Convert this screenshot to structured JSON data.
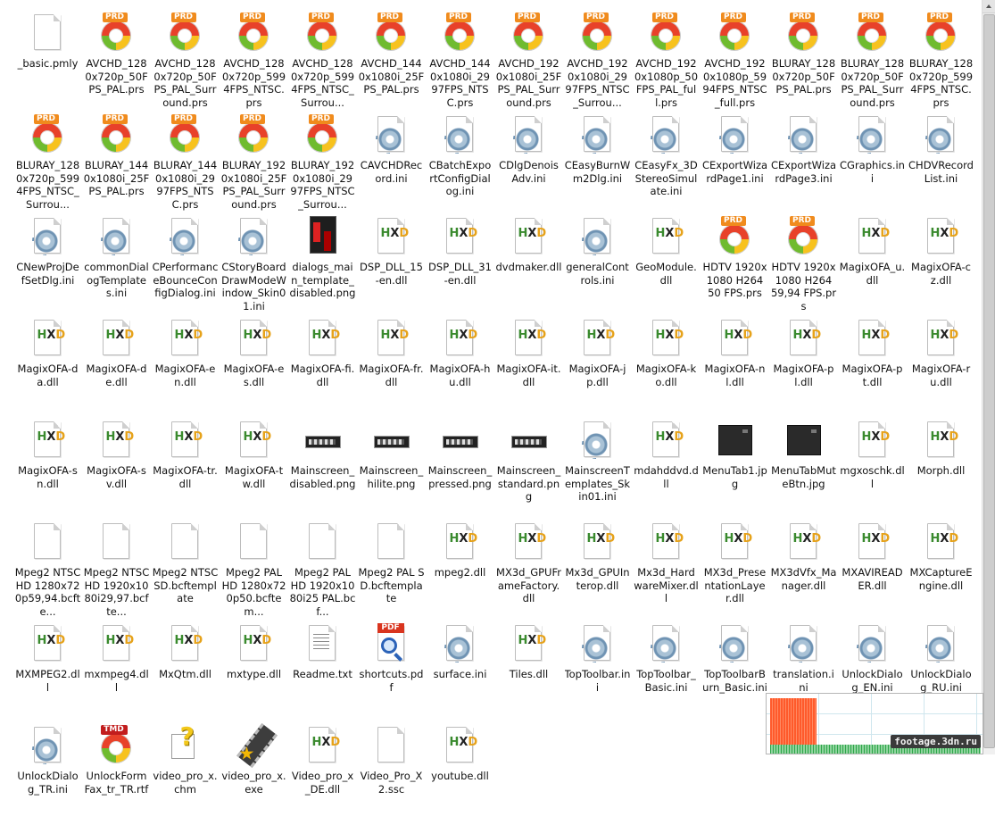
{
  "files": [
    {
      "name": "_basic.pmly",
      "icon": "document-icon"
    },
    {
      "name": "AVCHD_1280x720p_50FPS_PAL.prs",
      "icon": "prd-preset-icon"
    },
    {
      "name": "AVCHD_1280x720p_50FPS_PAL_Surround.prs",
      "icon": "prd-preset-icon"
    },
    {
      "name": "AVCHD_1280x720p_5994FPS_NTSC.prs",
      "icon": "prd-preset-icon"
    },
    {
      "name": "AVCHD_1280x720p_5994FPS_NTSC_Surrou...",
      "icon": "prd-preset-icon"
    },
    {
      "name": "AVCHD_1440x1080i_25FPS_PAL.prs",
      "icon": "prd-preset-icon"
    },
    {
      "name": "AVCHD_1440x1080i_2997FPS_NTSC.prs",
      "icon": "prd-preset-icon"
    },
    {
      "name": "AVCHD_1920x1080i_25FPS_PAL_Surround.prs",
      "icon": "prd-preset-icon"
    },
    {
      "name": "AVCHD_1920x1080i_2997FPS_NTSC_Surrou...",
      "icon": "prd-preset-icon"
    },
    {
      "name": "AVCHD_1920x1080p_50FPS_PAL_full.prs",
      "icon": "prd-preset-icon"
    },
    {
      "name": "AVCHD_1920x1080p_5994FPS_NTSC_full.prs",
      "icon": "prd-preset-icon"
    },
    {
      "name": "BLURAY_1280x720p_50FPS_PAL.prs",
      "icon": "prd-preset-icon"
    },
    {
      "name": "BLURAY_1280x720p_50FPS_PAL_Surround.prs",
      "icon": "prd-preset-icon"
    },
    {
      "name": "BLURAY_1280x720p_5994FPS_NTSC.prs",
      "icon": "prd-preset-icon"
    },
    {
      "name": "BLURAY_1280x720p_5994FPS_NTSC_Surrou...",
      "icon": "prd-preset-icon"
    },
    {
      "name": "BLURAY_1440x1080i_25FPS_PAL.prs",
      "icon": "prd-preset-icon"
    },
    {
      "name": "BLURAY_1440x1080i_2997FPS_NTSC.prs",
      "icon": "prd-preset-icon"
    },
    {
      "name": "BLURAY_1920x1080i_25FPS_PAL_Surround.prs",
      "icon": "prd-preset-icon"
    },
    {
      "name": "BLURAY_1920x1080i_2997FPS_NTSC_Surrou...",
      "icon": "prd-preset-icon"
    },
    {
      "name": "CAVCHDRecord.ini",
      "icon": "settings-file-icon"
    },
    {
      "name": "CBatchExportConfigDialog.ini",
      "icon": "settings-file-icon"
    },
    {
      "name": "CDlgDenoisAdv.ini",
      "icon": "settings-file-icon"
    },
    {
      "name": "CEasyBurnWm2Dlg.ini",
      "icon": "settings-file-icon"
    },
    {
      "name": "CEasyFx_3DStereoSimulate.ini",
      "icon": "settings-file-icon"
    },
    {
      "name": "CExportWizardPage1.ini",
      "icon": "settings-file-icon"
    },
    {
      "name": "CExportWizardPage3.ini",
      "icon": "settings-file-icon"
    },
    {
      "name": "CGraphics.ini",
      "icon": "settings-file-icon"
    },
    {
      "name": "CHDVRecordList.ini",
      "icon": "settings-file-icon"
    },
    {
      "name": "CNewProjDefSetDlg.ini",
      "icon": "settings-file-icon"
    },
    {
      "name": "commonDialogTemplates.ini",
      "icon": "settings-file-icon"
    },
    {
      "name": "CPerformanceBounceConfigDialog.ini",
      "icon": "settings-file-icon"
    },
    {
      "name": "CStoryBoardDrawModeWindow_Skin01.ini",
      "icon": "settings-file-icon"
    },
    {
      "name": "dialogs_main_template_disabled.png",
      "icon": "dialog-image-icon"
    },
    {
      "name": "DSP_DLL_15-en.dll",
      "icon": "dll-icon"
    },
    {
      "name": "DSP_DLL_31-en.dll",
      "icon": "dll-icon"
    },
    {
      "name": "dvdmaker.dll",
      "icon": "dll-icon"
    },
    {
      "name": "generalControls.ini",
      "icon": "settings-file-icon"
    },
    {
      "name": "GeoModule.dll",
      "icon": "dll-icon"
    },
    {
      "name": "HDTV 1920x1080 H264 50 FPS.prs",
      "icon": "prd-preset-icon"
    },
    {
      "name": "HDTV 1920x1080 H264 59,94 FPS.prs",
      "icon": "prd-preset-icon"
    },
    {
      "name": "MagixOFA_u.dll",
      "icon": "dll-icon"
    },
    {
      "name": "MagixOFA-cz.dll",
      "icon": "dll-icon"
    },
    {
      "name": "MagixOFA-da.dll",
      "icon": "dll-icon"
    },
    {
      "name": "MagixOFA-de.dll",
      "icon": "dll-icon"
    },
    {
      "name": "MagixOFA-en.dll",
      "icon": "dll-icon"
    },
    {
      "name": "MagixOFA-es.dll",
      "icon": "dll-icon"
    },
    {
      "name": "MagixOFA-fi.dll",
      "icon": "dll-icon"
    },
    {
      "name": "MagixOFA-fr.dll",
      "icon": "dll-icon"
    },
    {
      "name": "MagixOFA-hu.dll",
      "icon": "dll-icon"
    },
    {
      "name": "MagixOFA-it.dll",
      "icon": "dll-icon"
    },
    {
      "name": "MagixOFA-jp.dll",
      "icon": "dll-icon"
    },
    {
      "name": "MagixOFA-ko.dll",
      "icon": "dll-icon"
    },
    {
      "name": "MagixOFA-nl.dll",
      "icon": "dll-icon"
    },
    {
      "name": "MagixOFA-pl.dll",
      "icon": "dll-icon"
    },
    {
      "name": "MagixOFA-pt.dll",
      "icon": "dll-icon"
    },
    {
      "name": "MagixOFA-ru.dll",
      "icon": "dll-icon"
    },
    {
      "name": "MagixOFA-sn.dll",
      "icon": "dll-icon"
    },
    {
      "name": "MagixOFA-sv.dll",
      "icon": "dll-icon"
    },
    {
      "name": "MagixOFA-tr.dll",
      "icon": "dll-icon"
    },
    {
      "name": "MagixOFA-tw.dll",
      "icon": "dll-icon"
    },
    {
      "name": "Mainscreen_disabled.png",
      "icon": "strip-image-icon"
    },
    {
      "name": "Mainscreen_hilite.png",
      "icon": "strip-image-icon"
    },
    {
      "name": "Mainscreen_pressed.png",
      "icon": "strip-image-icon"
    },
    {
      "name": "Mainscreen_standard.png",
      "icon": "strip-image-icon"
    },
    {
      "name": "MainscreenTemplates_Skin01.ini",
      "icon": "settings-file-icon"
    },
    {
      "name": "mdahddvd.dll",
      "icon": "dll-icon"
    },
    {
      "name": "MenuTab1.jpg",
      "icon": "dark-image-icon"
    },
    {
      "name": "MenuTabMuteBtn.jpg",
      "icon": "dark-image-icon"
    },
    {
      "name": "mgxoschk.dll",
      "icon": "dll-icon"
    },
    {
      "name": "Morph.dll",
      "icon": "dll-icon"
    },
    {
      "name": "Mpeg2 NTSC HD 1280x720p59,94.bcfte...",
      "icon": "document-icon"
    },
    {
      "name": "Mpeg2 NTSC HD 1920x1080i29,97.bcfte...",
      "icon": "document-icon"
    },
    {
      "name": "Mpeg2 NTSC SD.bcftemplate",
      "icon": "document-icon"
    },
    {
      "name": "Mpeg2 PAL HD 1280x720p50.bcftem...",
      "icon": "document-icon"
    },
    {
      "name": "Mpeg2 PAL HD 1920x1080i25 PAL.bcf...",
      "icon": "document-icon"
    },
    {
      "name": "Mpeg2 PAL SD.bcftemplate",
      "icon": "document-icon"
    },
    {
      "name": "mpeg2.dll",
      "icon": "dll-icon"
    },
    {
      "name": "MX3d_GPUFrameFactory.dll",
      "icon": "dll-icon"
    },
    {
      "name": "Mx3d_GPUInterop.dll",
      "icon": "dll-icon"
    },
    {
      "name": "Mx3d_HardwareMixer.dll",
      "icon": "dll-icon"
    },
    {
      "name": "MX3d_PresentationLayer.dll",
      "icon": "dll-icon"
    },
    {
      "name": "MX3dVfx_Manager.dll",
      "icon": "dll-icon"
    },
    {
      "name": "MXAVIREADER.dll",
      "icon": "dll-icon"
    },
    {
      "name": "MXCaptureEngine.dll",
      "icon": "dll-icon"
    },
    {
      "name": "MXMPEG2.dll",
      "icon": "dll-icon"
    },
    {
      "name": "mxmpeg4.dll",
      "icon": "dll-icon"
    },
    {
      "name": "MxQtm.dll",
      "icon": "dll-icon"
    },
    {
      "name": "mxtype.dll",
      "icon": "dll-icon"
    },
    {
      "name": "Readme.txt",
      "icon": "text-file-icon"
    },
    {
      "name": "shortcuts.pdf",
      "icon": "pdf-icon"
    },
    {
      "name": "surface.ini",
      "icon": "settings-file-icon"
    },
    {
      "name": "Tiles.dll",
      "icon": "dll-icon"
    },
    {
      "name": "TopToolbar.ini",
      "icon": "settings-file-icon"
    },
    {
      "name": "TopToolbar_Basic.ini",
      "icon": "settings-file-icon"
    },
    {
      "name": "TopToolbarBurn_Basic.ini",
      "icon": "settings-file-icon"
    },
    {
      "name": "translation.ini",
      "icon": "settings-file-icon"
    },
    {
      "name": "UnlockDialog_EN.ini",
      "icon": "settings-file-icon"
    },
    {
      "name": "UnlockDialog_RU.ini",
      "icon": "settings-file-icon"
    },
    {
      "name": "UnlockDialog_TR.ini",
      "icon": "settings-file-icon"
    },
    {
      "name": "UnlockForm Fax_tr_TR.rtf",
      "icon": "tmd-preset-icon"
    },
    {
      "name": "video_pro_x.chm",
      "icon": "help-file-icon"
    },
    {
      "name": "video_pro_x.exe",
      "icon": "film-app-icon"
    },
    {
      "name": "Video_pro_x_DE.dll",
      "icon": "dll-icon"
    },
    {
      "name": "Video_Pro_X2.ssc",
      "icon": "document-icon"
    },
    {
      "name": "youtube.dll",
      "icon": "dll-icon"
    }
  ],
  "badges": {
    "prd": "PRD",
    "pdf": "PDF",
    "tmd": "TMD",
    "hxd_h": "H",
    "hxd_x": "X",
    "hxd_d": "D"
  },
  "watermark": "footage.3dn.ru",
  "colors": {
    "prd_badge": "#f08b1d",
    "pdf_badge": "#d9351f",
    "tmd_badge": "#c21d1d",
    "graph_red": "#ff5a2b",
    "graph_green": "#2fa64a"
  }
}
